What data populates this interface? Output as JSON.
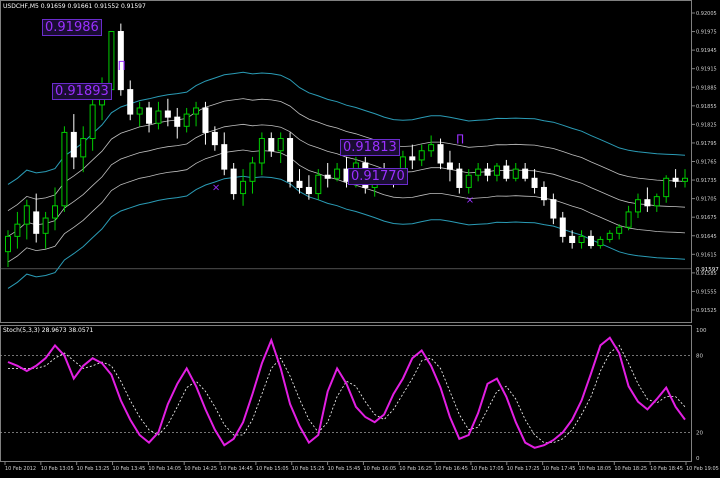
{
  "title": "USDCHF,M5",
  "ohlc_text": "0.91659 0.91661 0.91552 0.91597",
  "current_price": "0.91597",
  "oscillator_label": "Stoch(5,3,3) 28.9673 38.0571",
  "colors": {
    "background": "#000000",
    "bull_candle": "#00cc00",
    "bear_candle": "#ffffff",
    "outer_band": "#2a9bb5",
    "inner_band": "#bfbfbf",
    "stoch_main": "#e21fe2",
    "stoch_signal": "#ffffff",
    "annotation": "#9b30ff"
  },
  "annotations": [
    {
      "text": "0.91986"
    },
    {
      "text": "0.91893"
    },
    {
      "text": "0.91813"
    },
    {
      "text": "0.91770"
    }
  ],
  "price_axis": [
    "0.92005",
    "0.91975",
    "0.91945",
    "0.91915",
    "0.91885",
    "0.91855",
    "0.91825",
    "0.91795",
    "0.91765",
    "0.91735",
    "0.91705",
    "0.91675",
    "0.91645",
    "0.91615",
    "0.91585",
    "0.91555",
    "0.91525"
  ],
  "stoch_axis": [
    "100",
    "80",
    "20",
    "0"
  ],
  "time_axis": [
    "10 Feb 2012",
    "10 Feb 13:05",
    "10 Feb 13:25",
    "10 Feb 13:45",
    "10 Feb 14:05",
    "10 Feb 14:25",
    "10 Feb 14:45",
    "10 Feb 15:05",
    "10 Feb 15:25",
    "10 Feb 15:45",
    "10 Feb 16:05",
    "10 Feb 16:25",
    "10 Feb 16:45",
    "10 Feb 17:05",
    "10 Feb 17:25",
    "10 Feb 17:45",
    "10 Feb 18:05",
    "10 Feb 18:25",
    "10 Feb 18:45",
    "10 Feb 19:05"
  ],
  "chart_data": {
    "type": "candlestick",
    "symbol": "USDCHF",
    "timeframe": "M5",
    "ylim": [
      0.9151,
      0.9203
    ],
    "candles": [
      [
        0.91625,
        0.9166,
        0.916,
        0.9165
      ],
      [
        0.9165,
        0.9169,
        0.9163,
        0.9167
      ],
      [
        0.9167,
        0.9171,
        0.91645,
        0.917
      ],
      [
        0.9169,
        0.9172,
        0.9164,
        0.91655
      ],
      [
        0.91655,
        0.9169,
        0.9163,
        0.9168
      ],
      [
        0.9168,
        0.9173,
        0.9166,
        0.917
      ],
      [
        0.917,
        0.9183,
        0.9169,
        0.9182
      ],
      [
        0.9182,
        0.9185,
        0.9176,
        0.9178
      ],
      [
        0.9178,
        0.9183,
        0.91755,
        0.9181
      ],
      [
        0.9181,
        0.9188,
        0.9179,
        0.91865
      ],
      [
        0.91865,
        0.9191,
        0.9184,
        0.9189
      ],
      [
        0.9189,
        0.9196,
        0.9188,
        0.91985
      ],
      [
        0.91985,
        0.91998,
        0.9188,
        0.9189
      ],
      [
        0.9189,
        0.91905,
        0.9184,
        0.9185
      ],
      [
        0.9185,
        0.9187,
        0.9183,
        0.9186
      ],
      [
        0.9186,
        0.9187,
        0.9182,
        0.91835
      ],
      [
        0.91835,
        0.9187,
        0.91825,
        0.91855
      ],
      [
        0.91855,
        0.91875,
        0.9183,
        0.91845
      ],
      [
        0.91845,
        0.9186,
        0.9181,
        0.9183
      ],
      [
        0.9183,
        0.9186,
        0.9182,
        0.9185
      ],
      [
        0.9185,
        0.9187,
        0.9183,
        0.9186
      ],
      [
        0.9186,
        0.9187,
        0.918,
        0.9182
      ],
      [
        0.9182,
        0.9183,
        0.9179,
        0.918
      ],
      [
        0.918,
        0.9182,
        0.9175,
        0.9176
      ],
      [
        0.9176,
        0.9177,
        0.9171,
        0.9172
      ],
      [
        0.9172,
        0.9176,
        0.917,
        0.9174
      ],
      [
        0.9174,
        0.9178,
        0.9172,
        0.9177
      ],
      [
        0.9177,
        0.9182,
        0.9175,
        0.9181
      ],
      [
        0.9181,
        0.9182,
        0.9178,
        0.9179
      ],
      [
        0.9179,
        0.9182,
        0.9177,
        0.9181
      ],
      [
        0.9181,
        0.9182,
        0.9173,
        0.9174
      ],
      [
        0.9174,
        0.9176,
        0.9172,
        0.9173
      ],
      [
        0.9173,
        0.9175,
        0.9171,
        0.9172
      ],
      [
        0.9172,
        0.9176,
        0.9171,
        0.9175
      ],
      [
        0.9175,
        0.9177,
        0.9173,
        0.91745
      ],
      [
        0.91745,
        0.9177,
        0.9174,
        0.9176
      ],
      [
        0.9176,
        0.9178,
        0.9173,
        0.9174
      ],
      [
        0.9174,
        0.9178,
        0.9173,
        0.9177
      ],
      [
        0.9177,
        0.9178,
        0.9172,
        0.9173
      ],
      [
        0.9173,
        0.9176,
        0.91715,
        0.9175
      ],
      [
        0.9175,
        0.9177,
        0.91735,
        0.91745
      ],
      [
        0.91745,
        0.9176,
        0.9173,
        0.9174
      ],
      [
        0.9174,
        0.9179,
        0.91735,
        0.9178
      ],
      [
        0.9178,
        0.918,
        0.9176,
        0.91775
      ],
      [
        0.91775,
        0.918,
        0.91765,
        0.9179
      ],
      [
        0.9179,
        0.91815,
        0.9178,
        0.918
      ],
      [
        0.918,
        0.9181,
        0.9176,
        0.9177
      ],
      [
        0.9177,
        0.9179,
        0.9174,
        0.9176
      ],
      [
        0.9176,
        0.9177,
        0.9172,
        0.9173
      ],
      [
        0.9173,
        0.9176,
        0.9172,
        0.9175
      ],
      [
        0.9175,
        0.9177,
        0.9174,
        0.9176
      ],
      [
        0.9176,
        0.9177,
        0.9174,
        0.9175
      ],
      [
        0.9175,
        0.9177,
        0.9174,
        0.91765
      ],
      [
        0.91765,
        0.91775,
        0.9174,
        0.91745
      ],
      [
        0.91745,
        0.9177,
        0.9174,
        0.9176
      ],
      [
        0.9176,
        0.9177,
        0.9174,
        0.91745
      ],
      [
        0.91745,
        0.9176,
        0.9172,
        0.9173
      ],
      [
        0.9173,
        0.9174,
        0.917,
        0.9171
      ],
      [
        0.9171,
        0.9172,
        0.9167,
        0.9168
      ],
      [
        0.9168,
        0.9169,
        0.9164,
        0.9165
      ],
      [
        0.9165,
        0.9166,
        0.9163,
        0.9164
      ],
      [
        0.9164,
        0.9166,
        0.9163,
        0.9165
      ],
      [
        0.9165,
        0.9166,
        0.9163,
        0.91635
      ],
      [
        0.91635,
        0.9165,
        0.9163,
        0.91645
      ],
      [
        0.91645,
        0.9166,
        0.9164,
        0.91655
      ],
      [
        0.91655,
        0.9167,
        0.91645,
        0.91665
      ],
      [
        0.91665,
        0.917,
        0.9166,
        0.9169
      ],
      [
        0.9169,
        0.9172,
        0.9168,
        0.9171
      ],
      [
        0.9171,
        0.9173,
        0.9169,
        0.917
      ],
      [
        0.917,
        0.9172,
        0.9169,
        0.91715
      ],
      [
        0.91715,
        0.9175,
        0.91705,
        0.91745
      ],
      [
        0.91745,
        0.9176,
        0.9173,
        0.9174
      ],
      [
        0.9174,
        0.9176,
        0.9173,
        0.91745
      ]
    ],
    "stochastic": {
      "name": "Stoch(5,3,3)",
      "main_last": 28.9673,
      "signal_last": 38.0571,
      "levels": [
        80,
        20
      ],
      "main": [
        75,
        72,
        68,
        72,
        78,
        88,
        80,
        62,
        72,
        78,
        74,
        65,
        45,
        30,
        18,
        12,
        20,
        42,
        58,
        70,
        56,
        38,
        22,
        10,
        15,
        28,
        50,
        74,
        92,
        70,
        42,
        25,
        12,
        18,
        52,
        70,
        58,
        40,
        32,
        28,
        34,
        50,
        62,
        78,
        84,
        72,
        55,
        32,
        15,
        18,
        35,
        58,
        62,
        48,
        28,
        12,
        8,
        10,
        14,
        20,
        30,
        45,
        66,
        88,
        94,
        82,
        56,
        44,
        38,
        46,
        55,
        40,
        30
      ],
      "signal": [
        70,
        70,
        70,
        70,
        72,
        78,
        82,
        76,
        70,
        72,
        75,
        72,
        60,
        45,
        32,
        22,
        18,
        26,
        40,
        55,
        60,
        52,
        40,
        26,
        18,
        18,
        30,
        50,
        70,
        78,
        64,
        46,
        30,
        20,
        28,
        48,
        60,
        56,
        44,
        34,
        30,
        38,
        50,
        62,
        76,
        78,
        70,
        52,
        34,
        22,
        24,
        38,
        52,
        56,
        46,
        30,
        18,
        12,
        12,
        15,
        22,
        34,
        48,
        68,
        82,
        88,
        74,
        58,
        46,
        43,
        48,
        48,
        40
      ]
    }
  }
}
